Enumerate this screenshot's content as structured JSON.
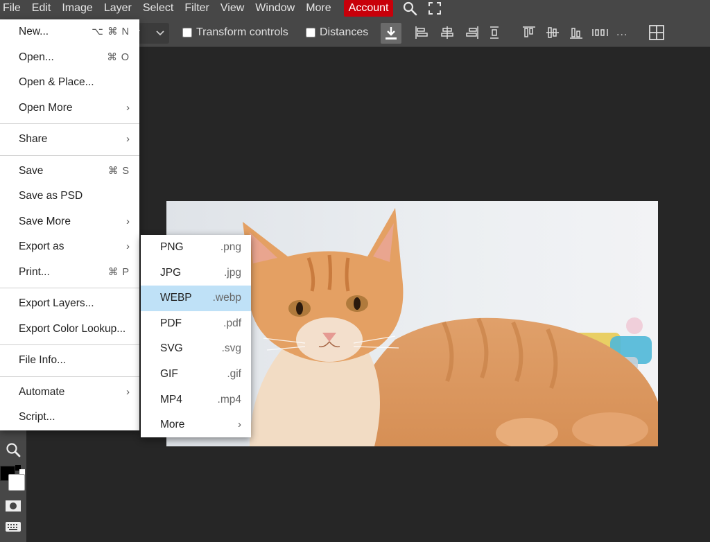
{
  "menubar": {
    "items": [
      {
        "label": "File"
      },
      {
        "label": "Edit"
      },
      {
        "label": "Image"
      },
      {
        "label": "Layer"
      },
      {
        "label": "Select"
      },
      {
        "label": "Filter"
      },
      {
        "label": "View"
      },
      {
        "label": "Window"
      },
      {
        "label": "More"
      }
    ],
    "account_label": "Account",
    "account_color": "#c8000a",
    "search_icon": "search-icon",
    "fullscreen_icon": "fullscreen-icon"
  },
  "toolbar": {
    "select_partial": "er",
    "transform_controls": "Transform controls",
    "distances": "Distances",
    "more": "..."
  },
  "file_menu": {
    "items": [
      {
        "label": "New...",
        "shortcut": "⌥ ⌘ N"
      },
      {
        "label": "Open...",
        "shortcut": "⌘ O"
      },
      {
        "label": "Open & Place...",
        "shortcut": ""
      },
      {
        "label": "Open More",
        "arrow": "›"
      },
      {
        "label": "Share",
        "arrow": "›"
      },
      {
        "label": "Save",
        "shortcut": "⌘ S"
      },
      {
        "label": "Save as PSD",
        "shortcut": ""
      },
      {
        "label": "Save More",
        "arrow": "›"
      },
      {
        "label": "Export as",
        "arrow": "›"
      },
      {
        "label": "Print...",
        "shortcut": "⌘ P"
      },
      {
        "label": "Export Layers...",
        "shortcut": ""
      },
      {
        "label": "Export Color Lookup...",
        "shortcut": ""
      },
      {
        "label": "File Info...",
        "shortcut": ""
      },
      {
        "label": "Automate",
        "arrow": "›"
      },
      {
        "label": "Script...",
        "shortcut": ""
      }
    ]
  },
  "export_menu": {
    "highlight_color": "#bfe1f7",
    "items": [
      {
        "label": "PNG",
        "ext": ".png"
      },
      {
        "label": "JPG",
        "ext": ".jpg"
      },
      {
        "label": "WEBP",
        "ext": ".webp",
        "highlighted": true
      },
      {
        "label": "PDF",
        "ext": ".pdf"
      },
      {
        "label": "SVG",
        "ext": ".svg"
      },
      {
        "label": "GIF",
        "ext": ".gif"
      },
      {
        "label": "MP4",
        "ext": ".mp4"
      },
      {
        "label": "More",
        "arrow": "›"
      }
    ]
  },
  "canvas": {
    "image_subject": "orange-tabby-cat-photo"
  }
}
